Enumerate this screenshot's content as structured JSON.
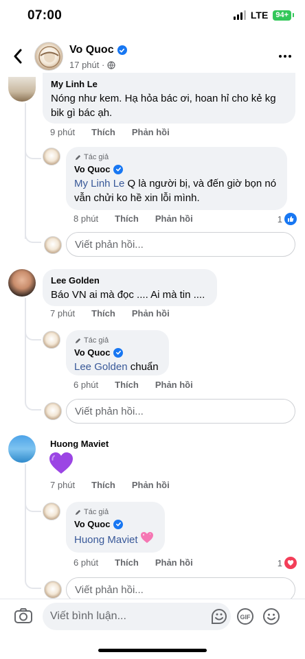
{
  "status": {
    "time": "07:00",
    "network": "LTE",
    "battery": "94+"
  },
  "header": {
    "name": "Vo Quoc",
    "meta": "17 phút ·"
  },
  "labels": {
    "like": "Thích",
    "reply": "Phản hồi",
    "author": "Tác giả",
    "write_reply": "Viết phản hồi...",
    "write_comment": "Viết bình luận..."
  },
  "comments": [
    {
      "name": "My Linh Le",
      "text": "Nóng như kem. Hạ hỏa bác ơi, hoan hỉ cho kẻ kg bik gì bác ạh.",
      "time": "9 phút",
      "reply": {
        "name": "Vo Quoc",
        "mention": "My Linh Le",
        "text": " Q là người bị, và đến giờ bọn nó vẫn chửi ko hề xin lỗi mình.",
        "time": "8 phút",
        "reaction_count": "1",
        "reaction": "like"
      }
    },
    {
      "name": "Lee Golden",
      "text": "Báo VN ai mà đọc .... Ai mà tin ....",
      "time": "7 phút",
      "reply": {
        "name": "Vo Quoc",
        "mention": "Lee Golden",
        "text": " chuẩn",
        "time": "6 phút"
      }
    },
    {
      "name": "Huong Maviet",
      "text": "",
      "emoji": "purple-heart",
      "time": "7 phút",
      "reply": {
        "name": "Vo Quoc",
        "mention": "Huong Maviet",
        "text": "",
        "emoji": "sparkling-heart",
        "time": "6 phút",
        "reaction_count": "1",
        "reaction": "love"
      }
    }
  ],
  "colors": {
    "accent": "#1877f2",
    "bubble": "#f0f2f5",
    "mention": "#385898",
    "heart": "#f33e58"
  }
}
